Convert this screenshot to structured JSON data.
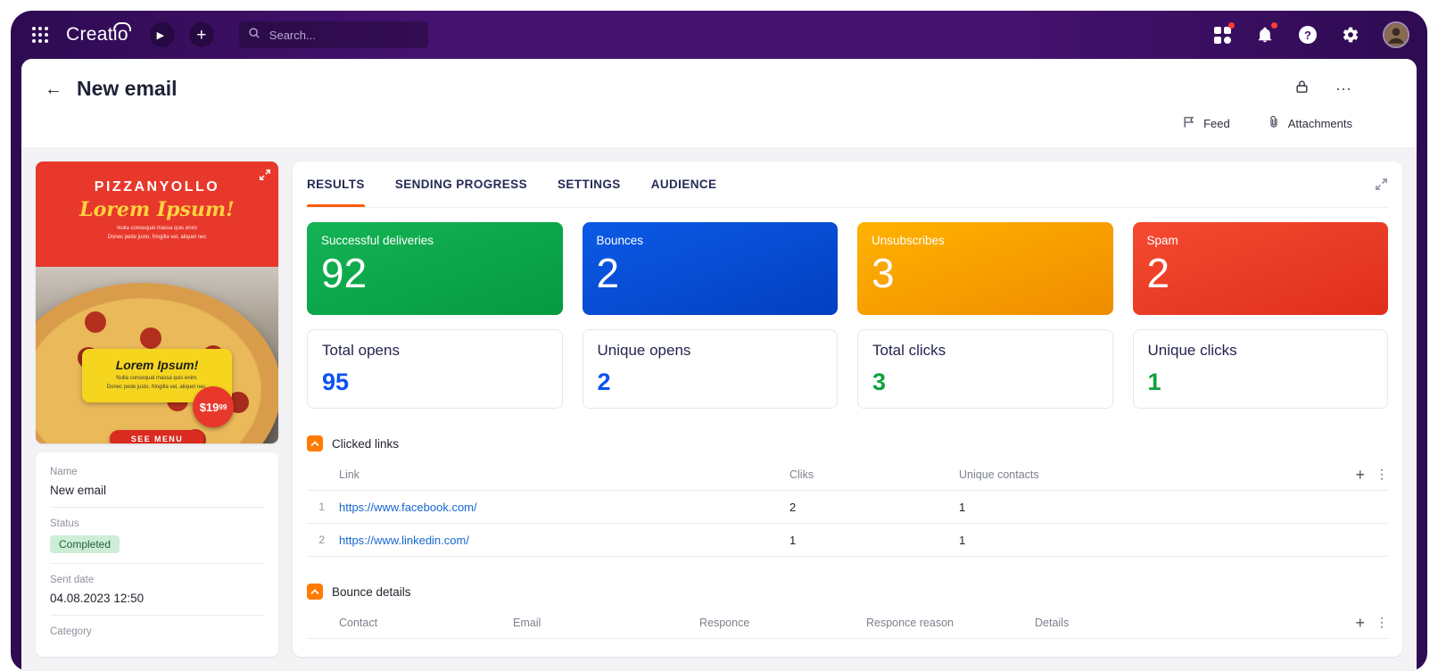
{
  "topbar": {
    "logo": "Creatio",
    "search_placeholder": "Search...",
    "play_glyph": "▶",
    "plus_glyph": "+",
    "help_glyph": "?"
  },
  "header": {
    "back_glyph": "←",
    "title": "New email",
    "more_glyph": "⋯",
    "feed_label": "Feed",
    "attachments_label": "Attachments"
  },
  "tabs": [
    {
      "label": "RESULTS",
      "active": true
    },
    {
      "label": "SENDING PROGRESS",
      "active": false
    },
    {
      "label": "SETTINGS",
      "active": false
    },
    {
      "label": "AUDIENCE",
      "active": false
    }
  ],
  "metrics": {
    "colored": [
      {
        "label": "Successful deliveries",
        "value": "92",
        "color": "#0CA74B"
      },
      {
        "label": "Bounces",
        "value": "2",
        "color": "#0350D8"
      },
      {
        "label": "Unsubscribes",
        "value": "3",
        "color": "#FC9F00"
      },
      {
        "label": "Spam",
        "value": "2",
        "color": "#EE3B24"
      }
    ],
    "plain": [
      {
        "label": "Total opens",
        "value": "95",
        "color": "#0B52F0"
      },
      {
        "label": "Unique opens",
        "value": "2",
        "color": "#0B52F0"
      },
      {
        "label": "Total clicks",
        "value": "3",
        "color": "#0FA23C"
      },
      {
        "label": "Unique clicks",
        "value": "1",
        "color": "#0FA23C"
      }
    ]
  },
  "clicked_links": {
    "title": "Clicked links",
    "columns": [
      "Link",
      "Cliks",
      "Unique contacts"
    ],
    "rows": [
      {
        "num": "1",
        "link": "https://www.facebook.com/",
        "clicks": "2",
        "unique_contacts": "1"
      },
      {
        "num": "2",
        "link": "https://www.linkedin.com/",
        "clicks": "1",
        "unique_contacts": "1"
      }
    ]
  },
  "bounce_details": {
    "title": "Bounce details",
    "columns": [
      "Contact",
      "Email",
      "Responce",
      "Responce reason",
      "Details"
    ]
  },
  "side_panel": {
    "fields": [
      {
        "label": "Name",
        "value": "New email"
      },
      {
        "label": "Status",
        "value": "Completed"
      },
      {
        "label": "Sent date",
        "value": "04.08.2023 12:50"
      },
      {
        "label": "Category",
        "value": ""
      }
    ]
  },
  "email_preview": {
    "brand": "PIZZANYOLLO",
    "headline": "Lorem Ipsum!",
    "intro_line1": "Nulla consequat massa quis enim",
    "intro_line2": "Donec pede justo, fringilla vel, aliquet nec",
    "badge_title": "Lorem Ipsum!",
    "badge_line1": "Nulla consequat massa quis enim.",
    "badge_line2": "Donec pede justo, fringilla vel, aliquet nec.",
    "price_main": "$19",
    "price_sup": "99",
    "cta": "SEE MENU"
  },
  "icons": {
    "app-launcher": "grid-dots",
    "run-process": "play-circle",
    "quick-add": "plus-circle",
    "search": "magnifier",
    "workplaces": "tiles",
    "notifications": "bell",
    "help": "question-circle",
    "settings": "gear",
    "profile": "avatar",
    "lock": "padlock",
    "more": "ellipsis",
    "feed": "flag",
    "attachments": "paperclip",
    "expand": "diagonal-arrows",
    "collapse": "chevron-up",
    "add-record": "plus",
    "row-menu": "kebab"
  },
  "colors": {
    "accent_orange": "#FF5A00",
    "topbar_purple": "#45126F",
    "status_badge_bg": "#CDEED6",
    "status_badge_text": "#27603D",
    "link": "#1667D0"
  }
}
